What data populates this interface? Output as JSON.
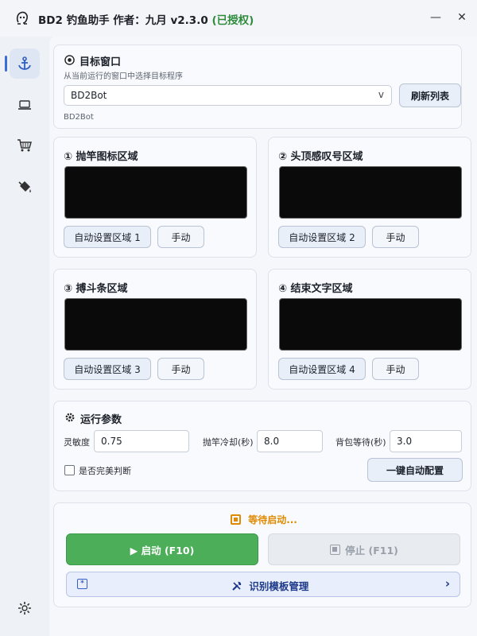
{
  "window": {
    "title": "BD2 钓鱼助手 作者：九月 v2.3.0",
    "license": "(已授权)",
    "minimize_glyph": "—",
    "close_glyph": "✕"
  },
  "sidebar": {
    "items": [
      {
        "name": "fishing",
        "icon": "anchor-icon"
      },
      {
        "name": "laptop",
        "icon": "laptop-icon"
      },
      {
        "name": "shop",
        "icon": "cart-icon"
      },
      {
        "name": "tools",
        "icon": "paint-bucket-icon"
      }
    ],
    "settings_icon": "gear-icon"
  },
  "target_window": {
    "title": "目标窗口",
    "subtitle": "从当前运行的窗口中选择目标程序",
    "selected": "BD2Bot",
    "refresh_label": "刷新列表",
    "current": "BD2Bot"
  },
  "regions": [
    {
      "title": "① 抛竿图标区域",
      "auto_label": "自动设置区域 1",
      "manual_label": "手动"
    },
    {
      "title": "② 头顶感叹号区域",
      "auto_label": "自动设置区域 2",
      "manual_label": "手动"
    },
    {
      "title": "③ 搏斗条区域",
      "auto_label": "自动设置区域 3",
      "manual_label": "手动"
    },
    {
      "title": "④ 结束文字区域",
      "auto_label": "自动设置区域 4",
      "manual_label": "手动"
    }
  ],
  "params": {
    "title": "运行参数",
    "sensitivity_label": "灵敏度",
    "sensitivity_value": "0.75",
    "cooldown_label": "抛竿冷却(秒)",
    "cooldown_value": "8.0",
    "bag_wait_label": "背包等待(秒)",
    "bag_wait_value": "3.0",
    "perfect_label": "是否完美判断",
    "perfect_checked": false,
    "auto_config_label": "一键自动配置"
  },
  "control": {
    "status": "等待启动...",
    "start_label": "▶ 启动 (F10)",
    "stop_label": "停止 (F11)",
    "templates_label": "识别模板管理",
    "chevron": "›"
  },
  "colors": {
    "accent": "#3a6fd8",
    "start_green": "#4cae59",
    "status_orange": "#e08a00",
    "license_green": "#2e8b3c"
  }
}
